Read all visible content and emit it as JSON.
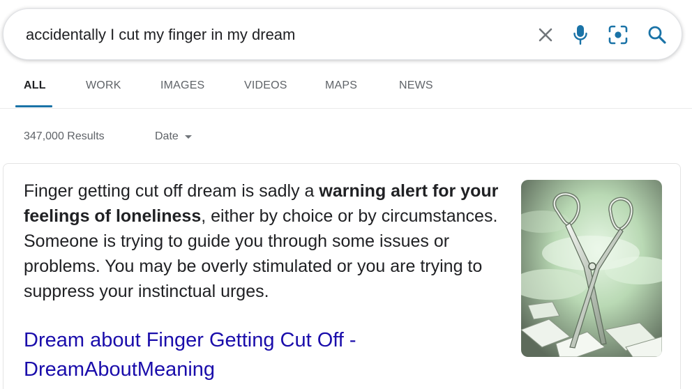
{
  "search": {
    "query": "accidentally I cut my finger in my dream",
    "icons": {
      "clear": "close-icon",
      "voice": "microphone-icon",
      "lens": "camera-lens-icon",
      "search": "search-icon"
    },
    "accent_color": "#1a73a7"
  },
  "tabs": [
    {
      "label": "ALL",
      "active": true
    },
    {
      "label": "WORK",
      "active": false
    },
    {
      "label": "IMAGES",
      "active": false
    },
    {
      "label": "VIDEOS",
      "active": false
    },
    {
      "label": "MAPS",
      "active": false
    },
    {
      "label": "NEWS",
      "active": false
    }
  ],
  "results_meta": {
    "count": "347,000 Results",
    "date_filter": "Date"
  },
  "featured": {
    "snippet_part1": "Finger getting cut off dream is sadly a ",
    "snippet_bold": "warning alert for your feelings of loneliness",
    "snippet_part2": ", either by choice or by circumstances. Someone is trying to guide you through some issues or problems. You may be overly stimulated or you are trying to suppress your instinctual urges.",
    "link_title": "Dream about Finger Getting Cut Off - DreamAboutMeaning",
    "link_color": "#1a0dab",
    "image": "scissors-illustration"
  }
}
